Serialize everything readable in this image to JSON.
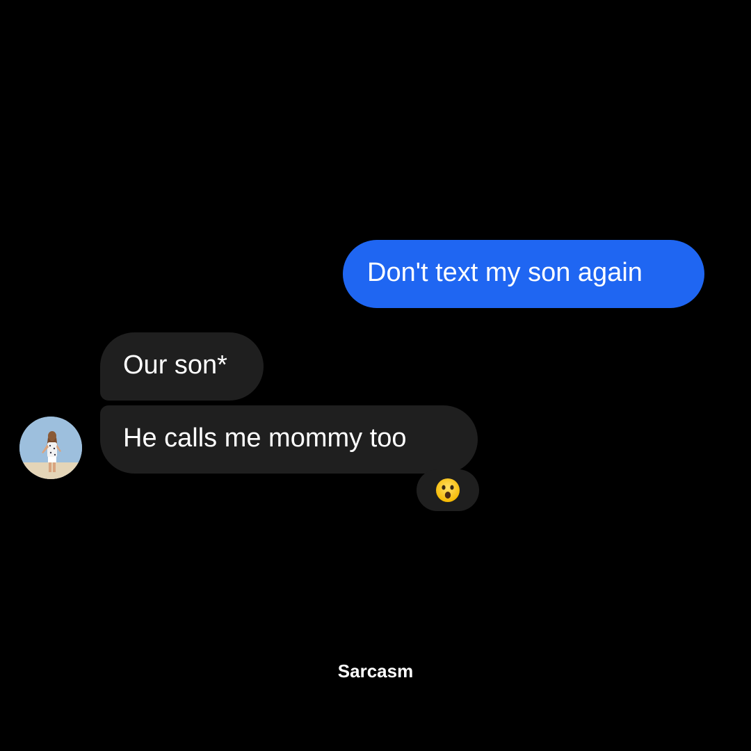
{
  "conversation": {
    "messages": [
      {
        "direction": "outgoing",
        "text": "Don't text my son again"
      },
      {
        "direction": "incoming",
        "text": "Our son*"
      },
      {
        "direction": "incoming",
        "text": "He calls me mommy too"
      }
    ],
    "reaction": {
      "emoji": "astonished-face-icon"
    },
    "avatar": {
      "icon": "profile-photo-avatar"
    }
  },
  "caption": "Sarcasm",
  "colors": {
    "background": "#000000",
    "outgoing_bubble": "#1f66f2",
    "incoming_bubble": "#1f1f1f",
    "text": "#ffffff"
  }
}
